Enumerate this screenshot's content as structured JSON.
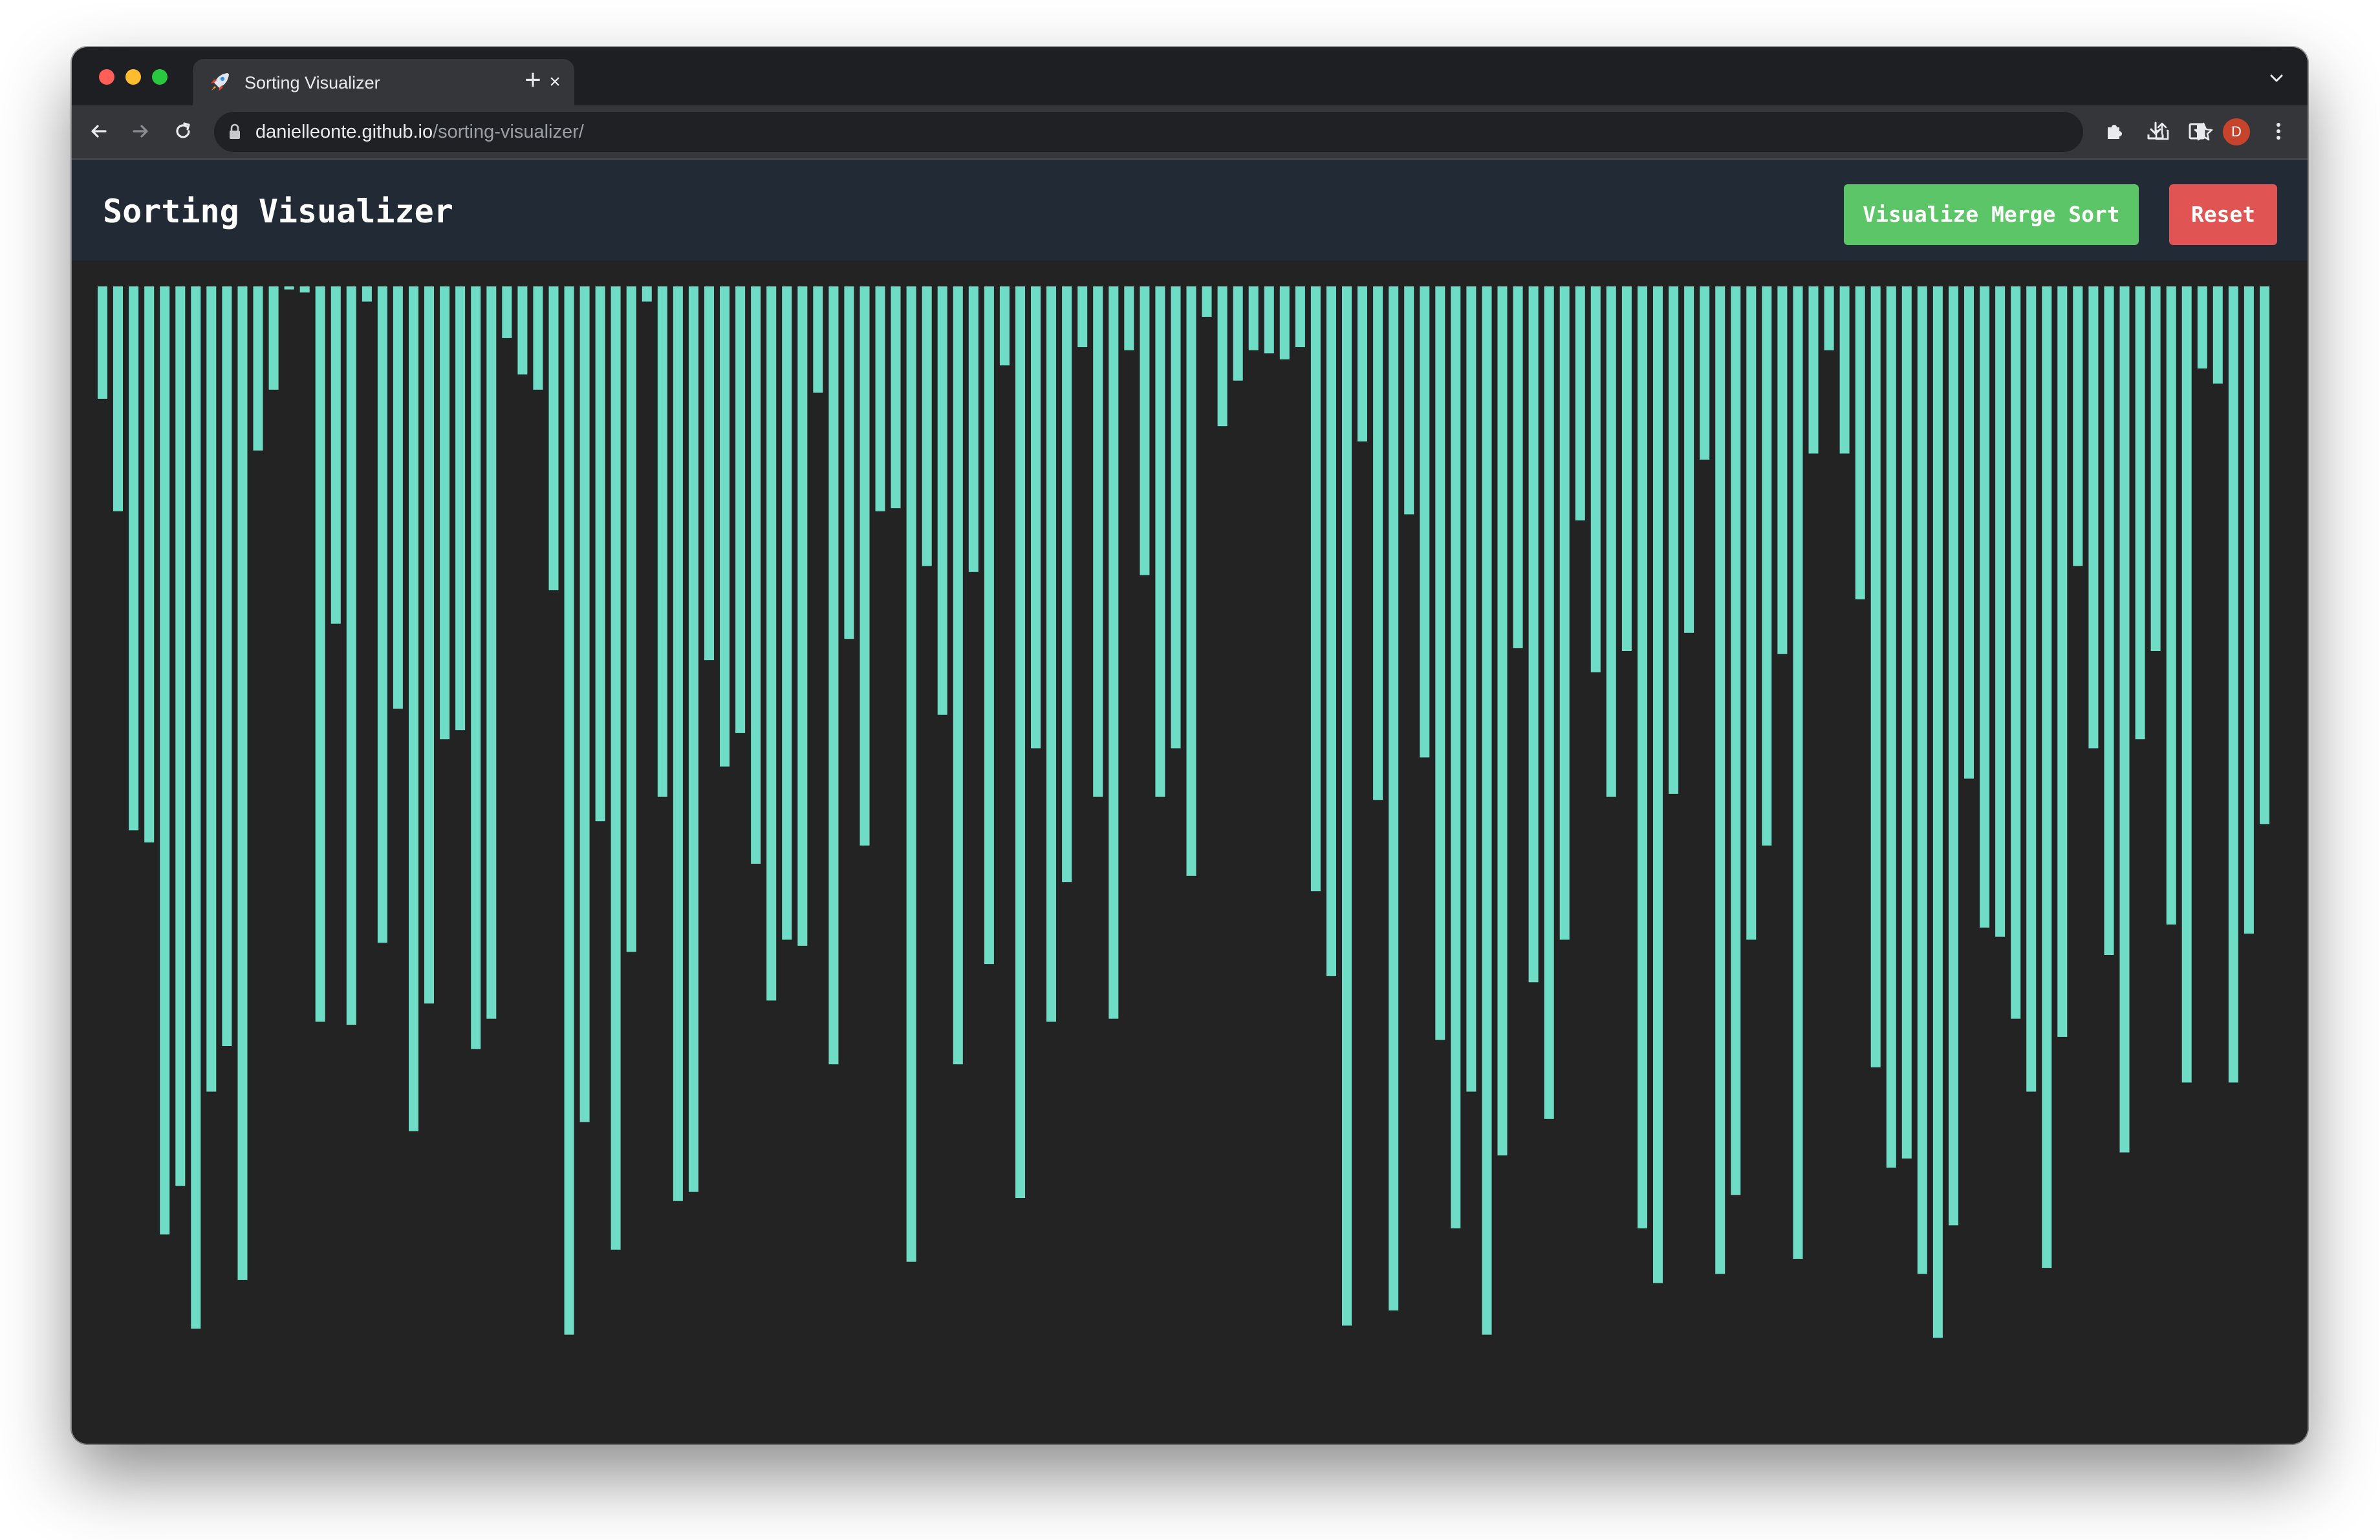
{
  "browser": {
    "tab_title": "Sorting Visualizer",
    "tab_close": "×",
    "new_tab": "+",
    "url_host": "danielleonte.github.io",
    "url_path": "/sorting-visualizer/",
    "avatar_initial": "D",
    "icons": [
      "rocket-icon",
      "back-arrow-icon",
      "forward-arrow-icon",
      "reload-icon",
      "lock-icon",
      "share-icon",
      "star-icon",
      "extensions-icon",
      "download-icon",
      "side-panel-icon",
      "kebab-menu-icon",
      "chevron-down-icon"
    ]
  },
  "app": {
    "title": "Sorting Visualizer",
    "merge_button": "Visualize Merge Sort",
    "reset_button": "Reset",
    "bar_color": "#6fdcc6",
    "background_color": "#232323",
    "header_color": "#222a36"
  },
  "array_values": [
    37,
    74,
    179,
    183,
    312,
    296,
    343,
    265,
    250,
    327,
    54,
    34,
    1,
    2,
    242,
    111,
    243,
    5,
    216,
    139,
    278,
    236,
    149,
    146,
    251,
    241,
    17,
    29,
    34,
    100,
    345,
    275,
    176,
    317,
    219,
    5,
    168,
    301,
    298,
    123,
    158,
    147,
    190,
    235,
    215,
    217,
    35,
    256,
    116,
    184,
    74,
    73,
    321,
    92,
    141,
    256,
    94,
    223,
    26,
    300,
    152,
    242,
    196,
    20,
    168,
    241,
    21,
    95,
    168,
    152,
    194,
    10,
    46,
    31,
    21,
    22,
    24,
    20,
    199,
    227,
    342,
    51,
    169,
    337,
    75,
    155,
    248,
    310,
    265,
    345,
    286,
    119,
    229,
    274,
    215,
    77,
    127,
    168,
    120,
    310,
    328,
    167,
    114,
    57,
    325,
    299,
    215,
    184,
    121,
    320,
    55,
    21,
    55,
    103,
    257,
    290,
    287,
    325,
    346,
    309,
    162,
    211,
    214,
    241,
    265,
    323,
    247,
    92,
    152,
    220,
    285,
    149,
    120,
    210,
    262,
    27,
    32,
    262,
    213,
    177
  ]
}
